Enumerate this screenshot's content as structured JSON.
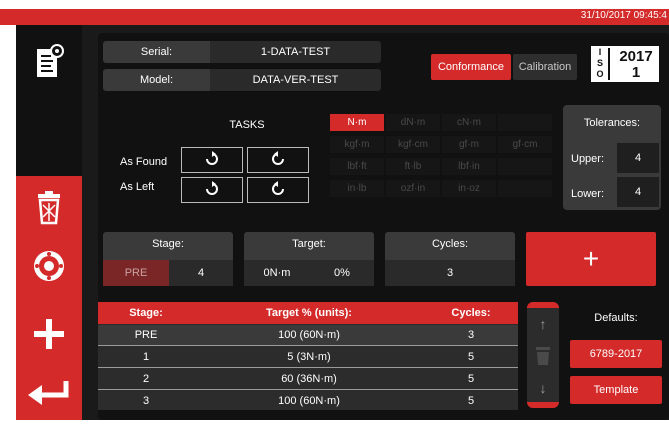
{
  "header": {
    "datetime": "31/10/2017 09:45:4"
  },
  "sidebar": {
    "items": [
      {
        "icon": "report-icon"
      },
      {
        "icon": "trash-icon"
      },
      {
        "icon": "wheel-icon"
      },
      {
        "icon": "plus-icon"
      },
      {
        "icon": "back-icon"
      }
    ]
  },
  "info": {
    "serial_label": "Serial:",
    "serial_value": "1-DATA-TEST",
    "model_label": "Model:",
    "model_value": "DATA-VER-TEST"
  },
  "mode": {
    "conformance": "Conformance",
    "calibration": "Calibration",
    "active": "Conformance"
  },
  "iso": {
    "letters": [
      "I",
      "S",
      "O"
    ],
    "year": "2017",
    "part": "1"
  },
  "tasks": {
    "title": "TASKS",
    "as_found": "As Found",
    "as_left": "As Left"
  },
  "units": {
    "rows": [
      [
        "N·m",
        "dN·m",
        "cN·m",
        ""
      ],
      [
        "kgf·m",
        "kgf·cm",
        "gf·m",
        "gf·cm"
      ],
      [
        "lbf·ft",
        "ft·lb",
        "lbf·in",
        ""
      ],
      [
        "in·lb",
        "ozf·in",
        "in·oz",
        ""
      ]
    ],
    "selected": "N·m"
  },
  "tolerances": {
    "title": "Tolerances:",
    "upper_label": "Upper:",
    "upper_value": "4",
    "lower_label": "Lower:",
    "lower_value": "4"
  },
  "stage_card": {
    "label": "Stage:",
    "stage": "PRE",
    "value": "4"
  },
  "target_card": {
    "label": "Target:",
    "unit": "0N·m",
    "percent": "0%"
  },
  "cycles_card": {
    "label": "Cycles:",
    "value": "3"
  },
  "add_label": "+",
  "table": {
    "headers": [
      "Stage:",
      "Target % (units):",
      "Cycles:"
    ],
    "rows": [
      [
        "PRE",
        "100 (60N·m)",
        "3"
      ],
      [
        "1",
        "5 (3N·m)",
        "5"
      ],
      [
        "2",
        "60 (36N·m)",
        "5"
      ],
      [
        "3",
        "100 (60N·m)",
        "5"
      ]
    ]
  },
  "scroll": {
    "up": "↑",
    "down": "↓"
  },
  "defaults": {
    "title": "Defaults:",
    "standard": "6789-2017",
    "template": "Template"
  },
  "colors": {
    "accent": "#d42a2a",
    "panel": "#111111"
  }
}
